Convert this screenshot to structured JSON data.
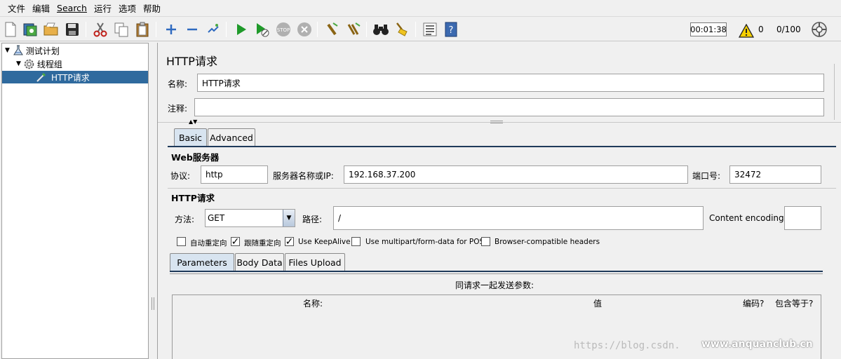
{
  "menu": [
    {
      "label": "文件"
    },
    {
      "label": "编辑"
    },
    {
      "label": "Search"
    },
    {
      "label": "运行"
    },
    {
      "label": "选项"
    },
    {
      "label": "帮助"
    }
  ],
  "toolbar": {
    "timer": "00:01:38",
    "warning_count": "0",
    "thread_count": "0/100"
  },
  "tree": {
    "items": [
      {
        "label": "测试计划"
      },
      {
        "label": "线程组"
      },
      {
        "label": "HTTP请求"
      }
    ]
  },
  "panel": {
    "title": "HTTP请求",
    "name_label": "名称:",
    "name_value": "HTTP请求",
    "comment_label": "注释:",
    "comment_value": "",
    "tabs": [
      {
        "label": "Basic"
      },
      {
        "label": "Advanced"
      }
    ],
    "web_server": {
      "title": "Web服务器",
      "protocol_label": "协议:",
      "protocol_value": "http",
      "server_label": "服务器名称或IP:",
      "server_value": "192.168.37.200",
      "port_label": "端口号:",
      "port_value": "32472"
    },
    "http_request": {
      "title": "HTTP请求",
      "method_label": "方法:",
      "method_value": "GET",
      "path_label": "路径:",
      "path_value": "/",
      "encoding_label": "Content encoding:",
      "encoding_value": ""
    },
    "options": [
      {
        "label": "自动重定向",
        "checked": false
      },
      {
        "label": "跟随重定向",
        "checked": true
      },
      {
        "label": "Use KeepAlive",
        "checked": true
      },
      {
        "label": "Use multipart/form-data for POST",
        "checked": false
      },
      {
        "label": "Browser-compatible headers",
        "checked": false
      }
    ],
    "sub_tabs": [
      {
        "label": "Parameters"
      },
      {
        "label": "Body Data"
      },
      {
        "label": "Files Upload"
      }
    ],
    "params": {
      "caption": "同请求一起发送参数:",
      "columns": [
        {
          "label": "名称:"
        },
        {
          "label": "值"
        },
        {
          "label": "编码?"
        },
        {
          "label": "包含等于?"
        }
      ]
    }
  },
  "watermarks": {
    "left": "https://blog.csdn.",
    "right": "www.anquanclub.cn"
  },
  "colors": {
    "selection": "#2f6a9e",
    "active_tab": "#d8e4f0",
    "run_green": "#1f9a2a"
  }
}
